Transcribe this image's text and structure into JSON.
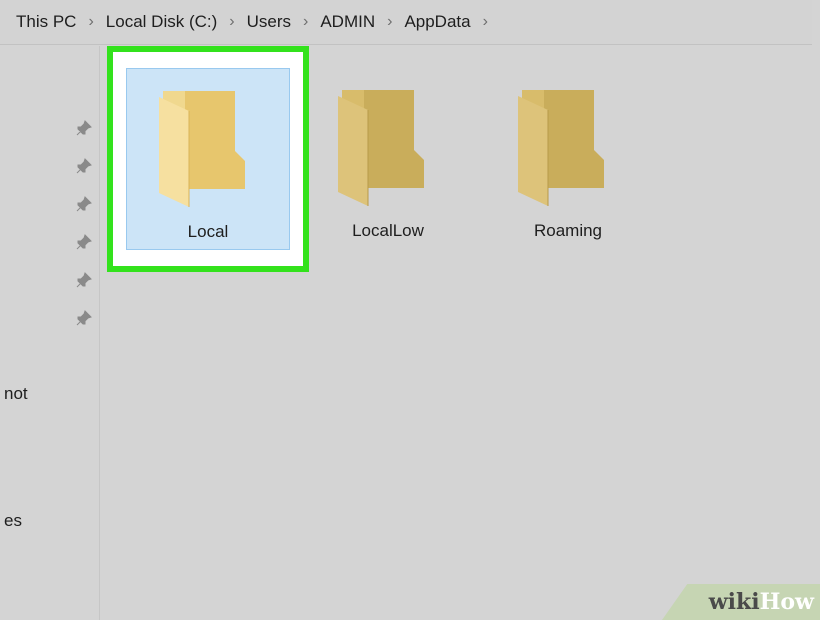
{
  "breadcrumb": {
    "items": [
      "This PC",
      "Local Disk (C:)",
      "Users",
      "ADMIN",
      "AppData"
    ],
    "separator": "›"
  },
  "nav": {
    "pinned_count": 6,
    "partial_labels": [
      "not",
      "es"
    ]
  },
  "folders": [
    {
      "name": "Local",
      "selected": true,
      "highlighted": true
    },
    {
      "name": "LocalLow",
      "selected": false
    },
    {
      "name": "Roaming",
      "selected": false
    }
  ],
  "watermark": {
    "part1": "wiki",
    "part2": "How"
  },
  "colors": {
    "highlight": "#33e21c",
    "selection": "#cce4f7",
    "folder": "#e2c574",
    "folder_dim": "#c9ad5b"
  }
}
